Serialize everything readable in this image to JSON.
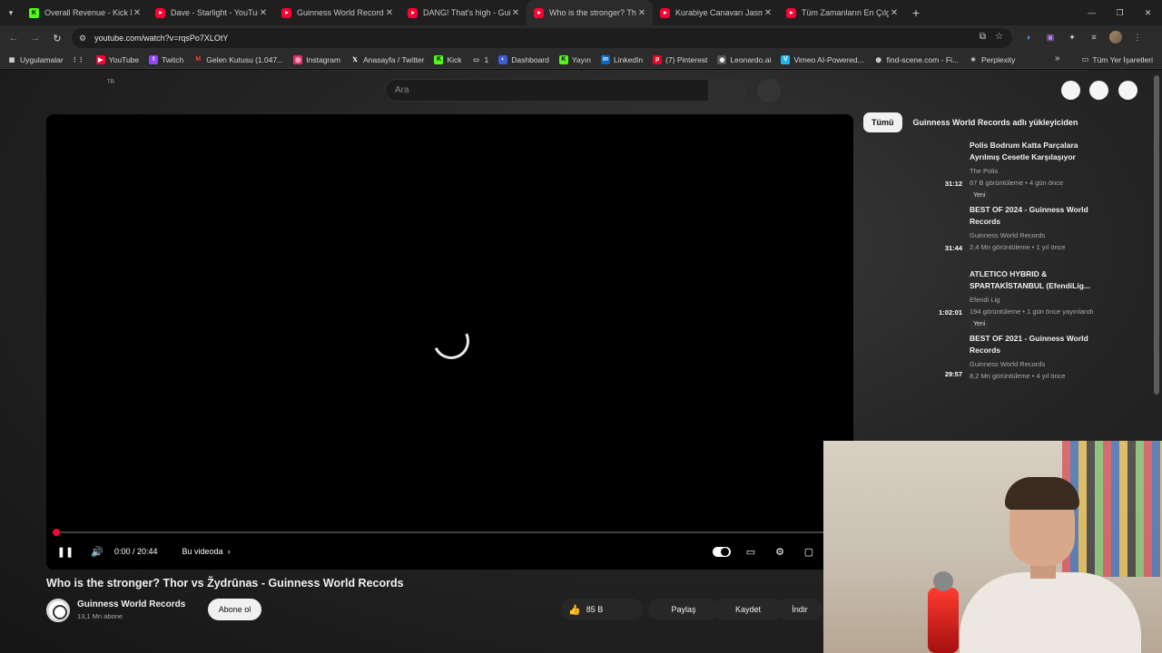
{
  "tabs": [
    {
      "title": "Overall Revenue - Kick Da",
      "icon": "kick",
      "active": false
    },
    {
      "title": "Dave - Starlight - YouTube",
      "icon": "youtube",
      "active": false
    },
    {
      "title": "Guinness World Records",
      "icon": "youtube",
      "active": false
    },
    {
      "title": "DANG! That's high - Guin",
      "icon": "youtube",
      "active": false
    },
    {
      "title": "Who is the stronger? Thor",
      "icon": "youtube",
      "active": true
    },
    {
      "title": "Kurabiye Canavarı Jasmin",
      "icon": "youtube",
      "active": false
    },
    {
      "title": "Tüm Zamanların En Çılgın",
      "icon": "youtube",
      "active": false
    }
  ],
  "address": {
    "url": "youtube.com/watch?v=rqsPo7XLOtY"
  },
  "bookmarks": [
    {
      "label": "Uygulamalar",
      "icon": "apps-grid-icon"
    },
    {
      "label": "",
      "icon": "apps-icon"
    },
    {
      "label": "YouTube",
      "icon": "youtube-icon"
    },
    {
      "label": "Twitch",
      "icon": "twitch-icon"
    },
    {
      "label": "Gelen Kutusu (1.047...",
      "icon": "gmail-icon"
    },
    {
      "label": "Instagram",
      "icon": "instagram-icon"
    },
    {
      "label": "Anasayfa / Twitter",
      "icon": "x-icon"
    },
    {
      "label": "Kick",
      "icon": "kick-icon"
    },
    {
      "label": "1",
      "icon": "folder-icon"
    },
    {
      "label": "Dashboard",
      "icon": "dashboard-icon"
    },
    {
      "label": "Yayın",
      "icon": "kick-icon"
    },
    {
      "label": "LinkedIn",
      "icon": "linkedin-icon"
    },
    {
      "label": "(7) Pinterest",
      "icon": "pinterest-icon"
    },
    {
      "label": "Leonardo.ai",
      "icon": "leonardo-icon"
    },
    {
      "label": "Vimeo AI-Powered...",
      "icon": "vimeo-icon"
    },
    {
      "label": "find-scene.com - Fi...",
      "icon": "findscene-icon"
    },
    {
      "label": "Perplexity",
      "icon": "perplexity-icon"
    }
  ],
  "bookmarks_all": "Tüm Yer İşaretleri",
  "masthead": {
    "region": "TR",
    "search_placeholder": "Ara"
  },
  "player": {
    "time": "0:00 / 20:44",
    "chapters_label": "Bu videoda",
    "progress_fraction": 0.0
  },
  "video": {
    "title": "Who is the stronger? Thor vs Žydrūnas - Guinness World Records",
    "channel": "Guinness World Records",
    "subscribers": "13,1 Mn abone",
    "subscribe_label": "Abone ol",
    "likes": "85 B",
    "share_label": "Paylaş",
    "save_label": "Kaydet",
    "download_label": "İndir"
  },
  "chips": [
    "Tümü",
    "Guinness World Records adlı yükleyiciden"
  ],
  "recommendations": [
    {
      "title": "Polis Bodrum Katta Parçalara Ayrılmış Cesetle Karşılaşıyor",
      "channel": "The Polis",
      "meta": "67 B görüntüleme • 4 gün önce",
      "badge": "Yeni",
      "duration": "31:12"
    },
    {
      "title": "BEST OF 2024 - Guinness World Records",
      "channel": "Guinness World Records",
      "meta": "2,4 Mn görüntüleme • 1 yıl önce",
      "badge": "",
      "duration": "31:44"
    },
    {
      "title": "ATLETICO HYBRID & SPARTAKİSTANBUL (EfendiLig...",
      "channel": "Efendi Lig",
      "meta": "194 görüntüleme • 1 gün önce yayınlandı",
      "badge": "Yeni",
      "duration": "1:02:01"
    },
    {
      "title": "BEST OF 2021 - Guinness World Records",
      "channel": "Guinness World Records",
      "meta": "8,2 Mn görüntüleme • 4 yıl önce",
      "badge": "",
      "duration": "29:57"
    }
  ],
  "colors": {
    "accent": "#ff0033",
    "background": "#0f0f0f",
    "kick": "#53fc18"
  }
}
